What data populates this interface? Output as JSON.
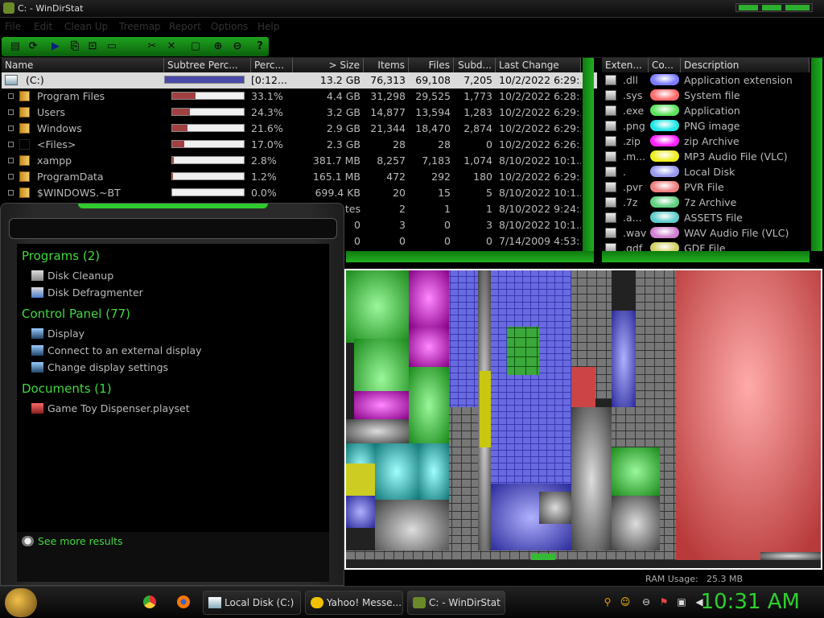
{
  "window": {
    "title": "C: - WinDirStat"
  },
  "menu": [
    "File",
    "Edit",
    "Clean Up",
    "Treemap",
    "Report",
    "Options",
    "Help"
  ],
  "toolbar_icons": [
    "open-icon",
    "refresh-icon",
    "play-icon",
    "copy-icon",
    "select-icon",
    "console-icon",
    "cleanup-icon",
    "delete-icon",
    "folder-icon",
    "zoom-in-icon",
    "zoom-out-icon",
    "help-icon"
  ],
  "tree": {
    "columns": [
      "Name",
      "Subtree Perc...",
      "Perc...",
      "> Size",
      "Items",
      "Files",
      "Subd...",
      "Last Change"
    ],
    "rows": [
      {
        "name": "(C:)",
        "perc": "[0:12...",
        "size": "13.2 GB",
        "items": "76,313",
        "files": "69,108",
        "subd": "7,205",
        "last": "10/2/2022 6:29:...",
        "fill": 1.0
      },
      {
        "name": "Program Files",
        "perc": "33.1%",
        "size": "4.4 GB",
        "items": "31,298",
        "files": "29,525",
        "subd": "1,773",
        "last": "10/2/2022 6:28:...",
        "fill": 0.331
      },
      {
        "name": "Users",
        "perc": "24.3%",
        "size": "3.2 GB",
        "items": "14,877",
        "files": "13,594",
        "subd": "1,283",
        "last": "10/2/2022 6:29:...",
        "fill": 0.243
      },
      {
        "name": "Windows",
        "perc": "21.6%",
        "size": "2.9 GB",
        "items": "21,344",
        "files": "18,470",
        "subd": "2,874",
        "last": "10/2/2022 6:29:...",
        "fill": 0.216
      },
      {
        "name": "<Files>",
        "perc": "17.0%",
        "size": "2.3 GB",
        "items": "28",
        "files": "28",
        "subd": "0",
        "last": "10/2/2022 6:26:...",
        "fill": 0.17
      },
      {
        "name": "xampp",
        "perc": "2.8%",
        "size": "381.7 MB",
        "items": "8,257",
        "files": "7,183",
        "subd": "1,074",
        "last": "8/10/2022 10:1...",
        "fill": 0.028
      },
      {
        "name": "ProgramData",
        "perc": "1.2%",
        "size": "165.1 MB",
        "items": "472",
        "files": "292",
        "subd": "180",
        "last": "10/2/2022 6:29:...",
        "fill": 0.012
      },
      {
        "name": "$WINDOWS.~BT",
        "perc": "0.0%",
        "size": "699.4 KB",
        "items": "20",
        "files": "15",
        "subd": "5",
        "last": "8/10/2022 10:1...",
        "fill": 0.0
      },
      {
        "name": "",
        "perc": "",
        "size": "tes",
        "items": "2",
        "files": "1",
        "subd": "1",
        "last": "8/10/2022 9:24:...",
        "fill": null
      },
      {
        "name": "",
        "perc": "",
        "size": "0",
        "items": "3",
        "files": "0",
        "subd": "3",
        "last": "8/10/2022 10:1...",
        "fill": null
      },
      {
        "name": "",
        "perc": "",
        "size": "0",
        "items": "0",
        "files": "0",
        "subd": "0",
        "last": "7/14/2009 4:53:...",
        "fill": null
      }
    ]
  },
  "extensions": {
    "columns": [
      "Exten...",
      "Co...",
      "Description"
    ],
    "rows": [
      {
        "ext": ".dll",
        "color": "#7b7bff",
        "desc": "Application extension"
      },
      {
        "ext": ".sys",
        "color": "#ff6b6b",
        "desc": "System file"
      },
      {
        "ext": ".exe",
        "color": "#5ce35c",
        "desc": "Application"
      },
      {
        "ext": ".png",
        "color": "#22e6e6",
        "desc": "PNG image"
      },
      {
        "ext": ".zip",
        "color": "#ff22ff",
        "desc": "zip Archive"
      },
      {
        "ext": ".m...",
        "color": "#eeee22",
        "desc": "MP3 Audio File (VLC)"
      },
      {
        "ext": ".",
        "color": "#9898ee",
        "desc": "Local Disk"
      },
      {
        "ext": ".pvr",
        "color": "#ee8080",
        "desc": "PVR File"
      },
      {
        "ext": ".7z",
        "color": "#60d080",
        "desc": "7z Archive"
      },
      {
        "ext": ".a...",
        "color": "#60cccc",
        "desc": "ASSETS File"
      },
      {
        "ext": ".wav",
        "color": "#d080d0",
        "desc": "WAV Audio File (VLC)"
      },
      {
        "ext": ".gdf",
        "color": "#d0d060",
        "desc": "GDF File"
      }
    ]
  },
  "startmenu": {
    "groups": [
      {
        "title": "Programs (2)",
        "items": [
          {
            "label": "Disk Cleanup",
            "icon": "disk-cleanup-icon"
          },
          {
            "label": "Disk Defragmenter",
            "icon": "defrag-icon"
          }
        ]
      },
      {
        "title": "Control Panel (77)",
        "items": [
          {
            "label": "Display",
            "icon": "display-icon"
          },
          {
            "label": "Connect to an external display",
            "icon": "display-icon"
          },
          {
            "label": "Change display settings",
            "icon": "display-icon"
          }
        ]
      },
      {
        "title": "Documents (1)",
        "items": [
          {
            "label": "Game Toy Dispenser.playset",
            "icon": "playset-icon"
          }
        ]
      }
    ],
    "see_more": "See more results"
  },
  "status": {
    "ram_label": "RAM Usage:",
    "ram_value": "25.3 MB"
  },
  "taskbar": {
    "buttons": [
      {
        "label": "Local Disk (C:)",
        "icon": "drive-icon"
      },
      {
        "label": "Yahoo! Messe...",
        "icon": "yahoo-messenger-icon"
      },
      {
        "label": "C: - WinDirStat",
        "icon": "windirstat-icon"
      }
    ],
    "clock": "10:31 AM"
  },
  "colors": {
    "accent": "#2ecb2e",
    "bar_fill": "#a04040",
    "root_bar": "#4a4aa8"
  }
}
